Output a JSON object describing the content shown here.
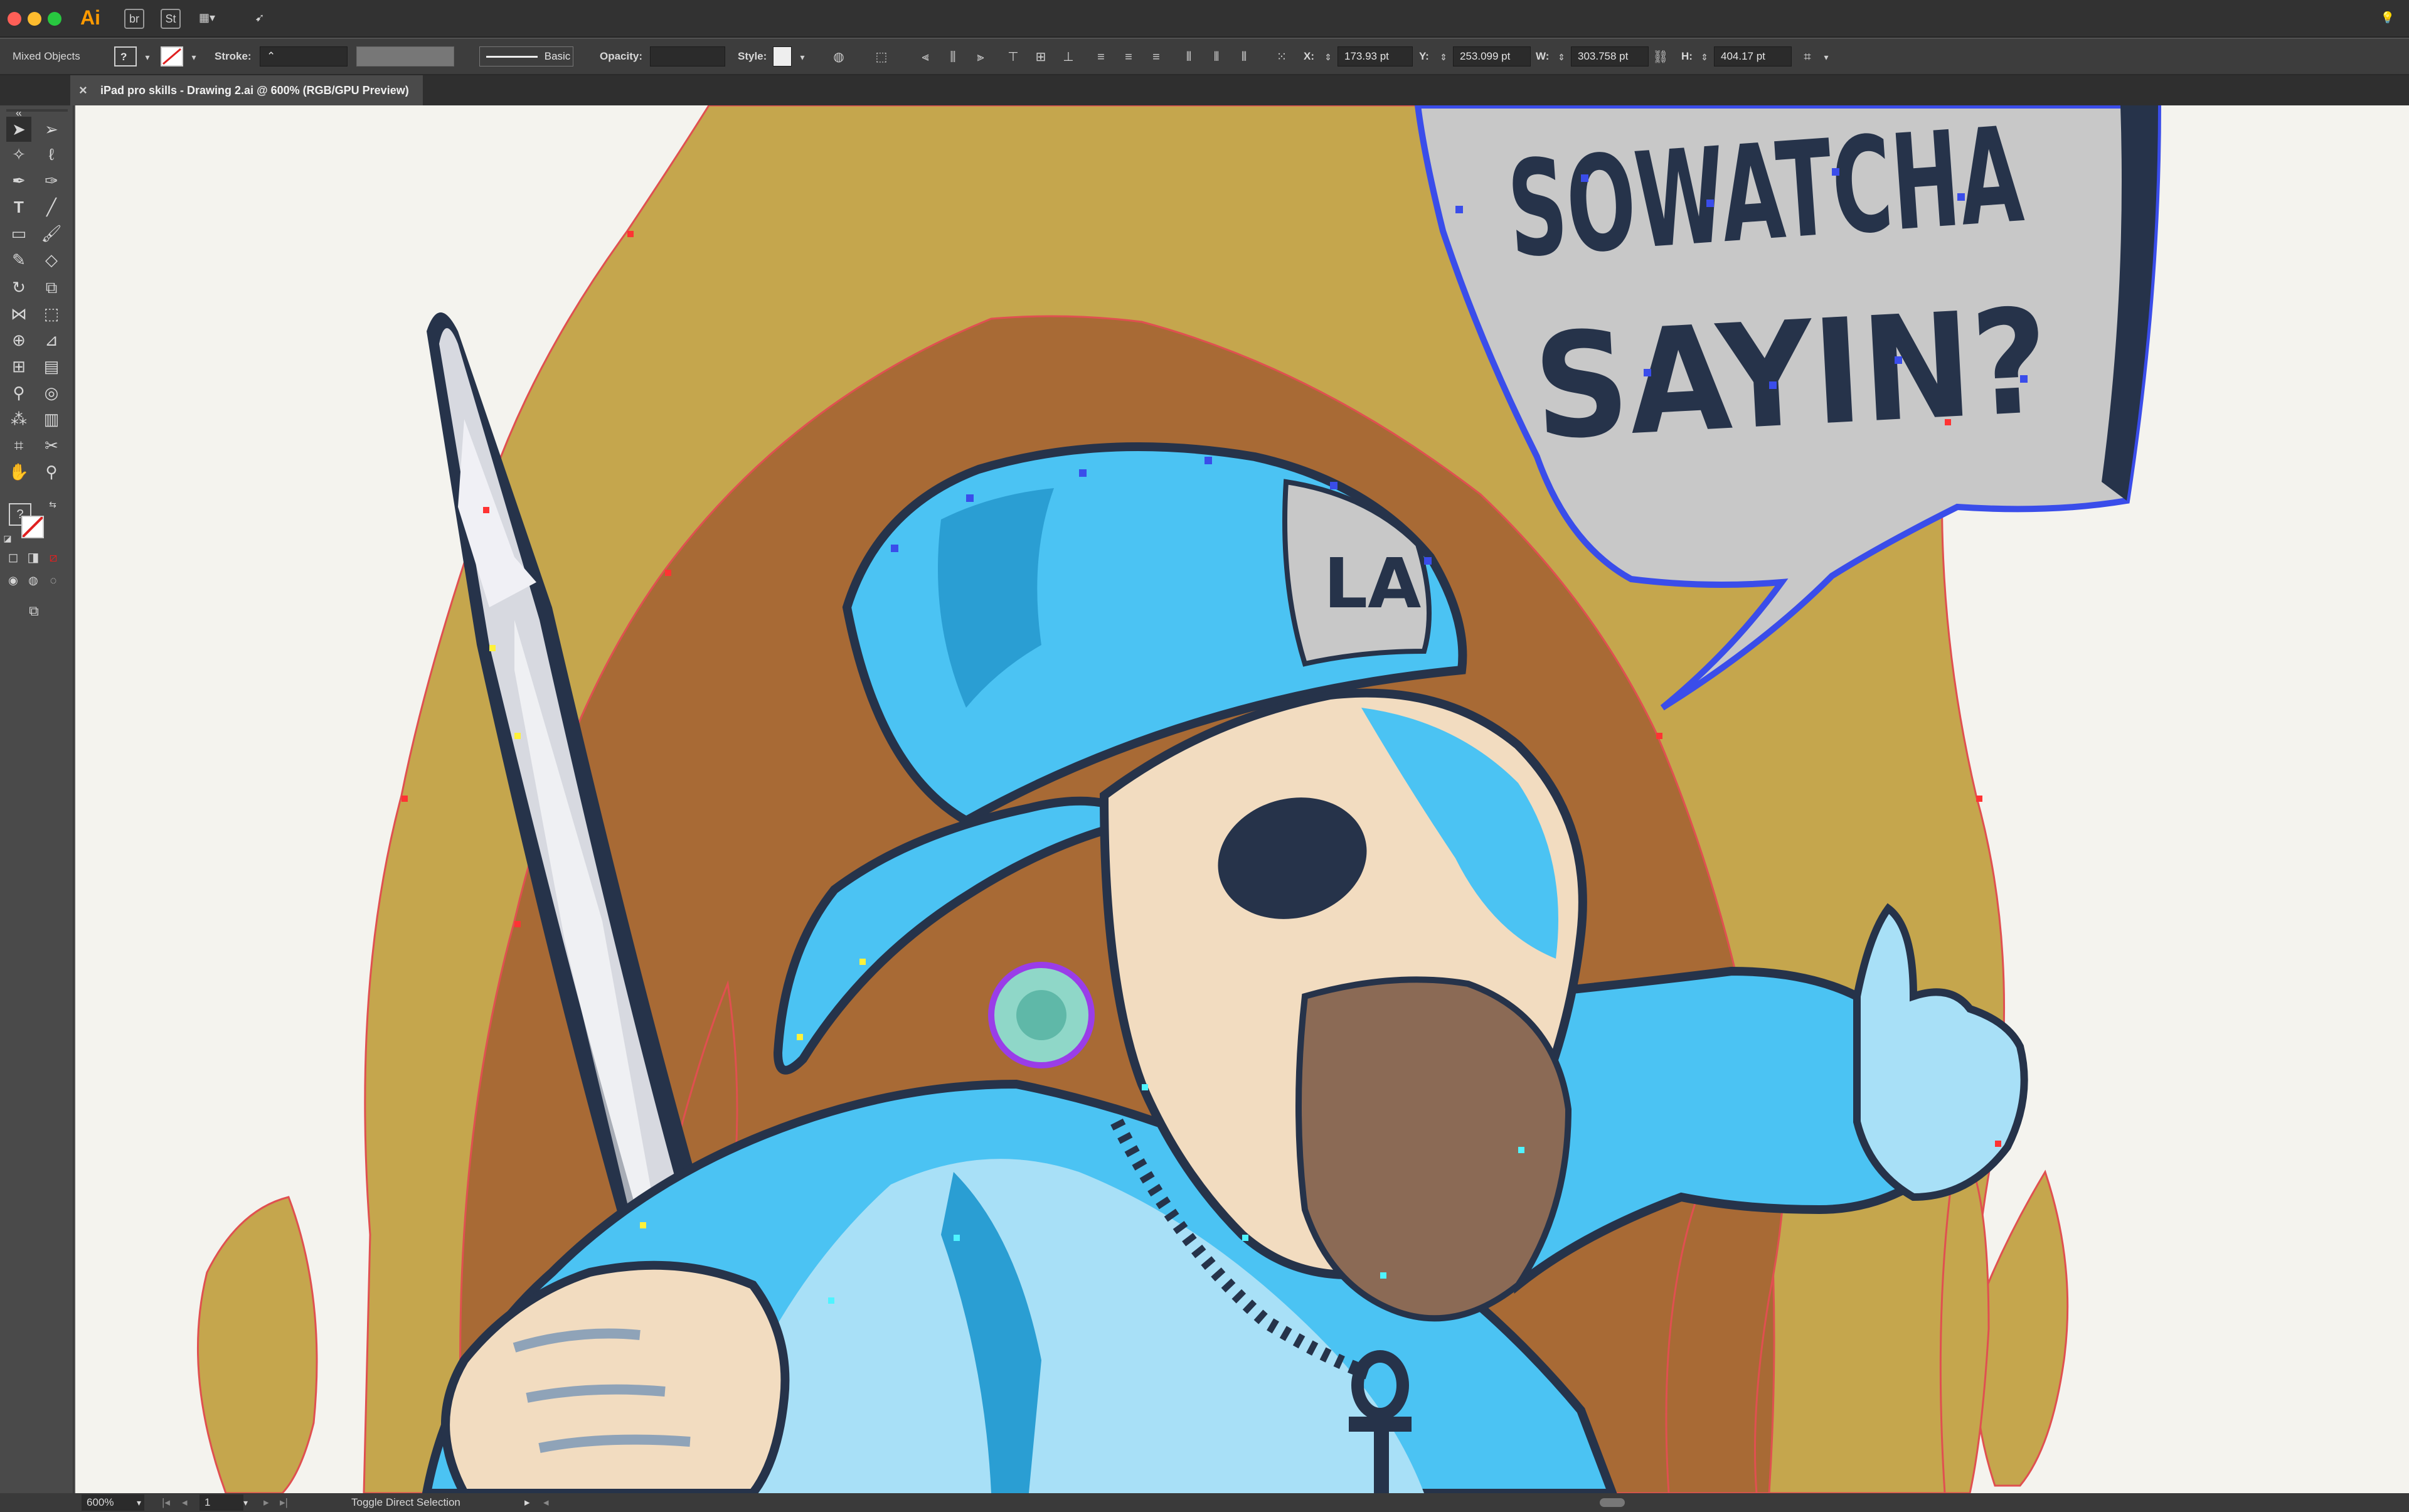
{
  "window": {
    "app_label": "Ai",
    "traffic_colors": [
      "#fe5f57",
      "#febc2e",
      "#28c840"
    ],
    "titlebar_icons": [
      "br",
      "St"
    ]
  },
  "control_bar": {
    "selection_label": "Mixed Objects",
    "fill_value": "?",
    "stroke_label": "Stroke:",
    "brush_label": "Basic",
    "opacity_label": "Opacity:",
    "style_label": "Style:",
    "x_label": "X:",
    "x_value": "173.93 pt",
    "y_label": "Y:",
    "y_value": "253.099 pt",
    "w_label": "W:",
    "w_value": "303.758 pt",
    "h_label": "H:",
    "h_value": "404.17 pt"
  },
  "document": {
    "tab_title": "iPad pro skills - Drawing 2.ai @ 600% (RGB/GPU Preview)",
    "close_glyph": "×"
  },
  "artwork": {
    "speech_line1": "SOWATCHA",
    "speech_line2": "SAYIN?",
    "cap_letters": "LA",
    "colors": {
      "background": "#f4f3ee",
      "flame_outer": "#c5a64d",
      "flame_inner": "#a86a35",
      "outfit_blue": "#4bc3f3",
      "outfit_light": "#a8e0f7",
      "outfit_dark": "#2a9ed3",
      "outline": "#26334a",
      "skin": "#f2dcc0",
      "bubble": "#c8c8c8",
      "anchor_blue": "#3a4dea",
      "anchor_cyan": "#4ff3ff",
      "anchor_red": "#ff3333",
      "anchor_yellow": "#fff13a"
    }
  },
  "status_bar": {
    "zoom": "600%",
    "artboard_number": "1",
    "current_tool": "Toggle Direct Selection"
  }
}
